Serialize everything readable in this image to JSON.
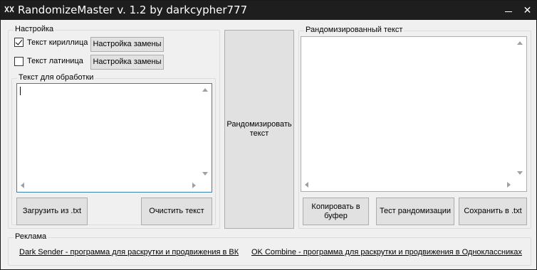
{
  "window": {
    "title": "RandomizeMaster v. 1.2 by darkcypher777",
    "close_glyph": "✕"
  },
  "settings": {
    "legend": "Настройка",
    "cyrillic": {
      "label": "Текст кириллица",
      "checked": true,
      "button": "Настройка замены"
    },
    "latin": {
      "label": "Текст латиница",
      "checked": false,
      "button": "Настройка замены"
    }
  },
  "input_group": {
    "legend": "Текст для обработки",
    "text": "",
    "load_button": "Загрузить из .txt",
    "clear_button": "Очистить текст"
  },
  "randomize_button": {
    "line1": "Рандомизировать",
    "line2": "текст"
  },
  "output_group": {
    "legend": "Рандомизированный текст",
    "text": "",
    "copy_button": {
      "line1": "Копировать в",
      "line2": "буфер"
    },
    "test_button": "Тест рандомизации",
    "save_button": "Сохранить в .txt"
  },
  "ads": {
    "legend": "Реклама",
    "link1": "Dark Sender - программа для раскрутки и продвижения в ВК",
    "link2": "OK Combine - программа для раскрутки и продвижения в Одноклассниках"
  }
}
